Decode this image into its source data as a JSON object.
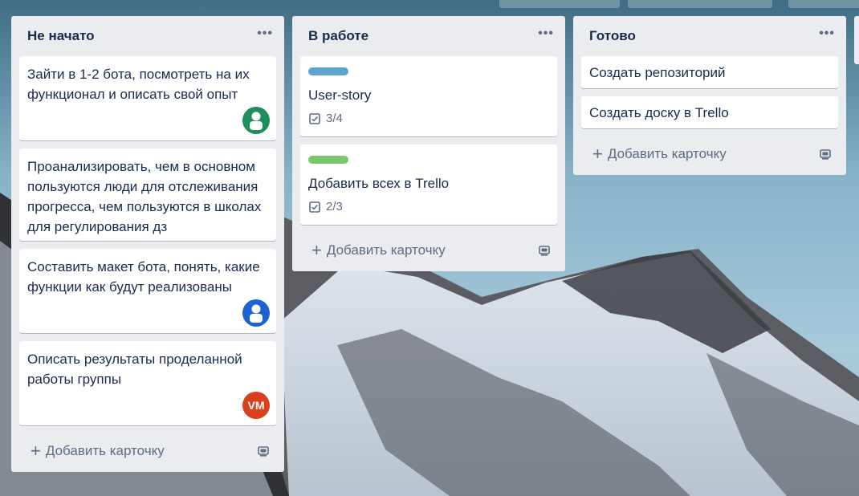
{
  "lists": [
    {
      "title": "Не начато",
      "cards": [
        {
          "text": "Зайти в 1-2 бота, посмотреть на их функционал и описать свой опыт",
          "avatar": {
            "type": "user-icon",
            "color": "#1e8f5a"
          }
        },
        {
          "text": "Проанализировать, чем в основном пользуются люди для отслеживания прогресса, чем пользуются в школах для регулирования дз"
        },
        {
          "text": "Составить макет бота, понять, какие функции как будут реализованы",
          "avatar": {
            "type": "user-icon",
            "color": "#1d62d0"
          }
        },
        {
          "text": "Описать результаты проделанной работы группы",
          "avatar": {
            "type": "initials",
            "initials": "VM",
            "color": "#d9411e"
          }
        }
      ],
      "add_card_label": "Добавить карточку"
    },
    {
      "title": "В работе",
      "cards": [
        {
          "label_color": "#5ba4cf",
          "text": "User-story",
          "checklist": "3/4"
        },
        {
          "label_color": "#7bc86c",
          "text": "Добавить всех в Trello",
          "checklist": "2/3"
        }
      ],
      "add_card_label": "Добавить карточку"
    },
    {
      "title": "Готово",
      "cards": [
        {
          "text": "Создать репозиторий"
        },
        {
          "text": "Создать доску в Trello"
        }
      ],
      "add_card_label": "Добавить карточку"
    }
  ],
  "menu_icon": "more-dots-icon",
  "template_icon": "card-template-icon",
  "colors": {
    "list_bg": "#ebecf0",
    "card_bg": "#ffffff",
    "text": "#172b4d",
    "muted": "#5e6c84"
  }
}
